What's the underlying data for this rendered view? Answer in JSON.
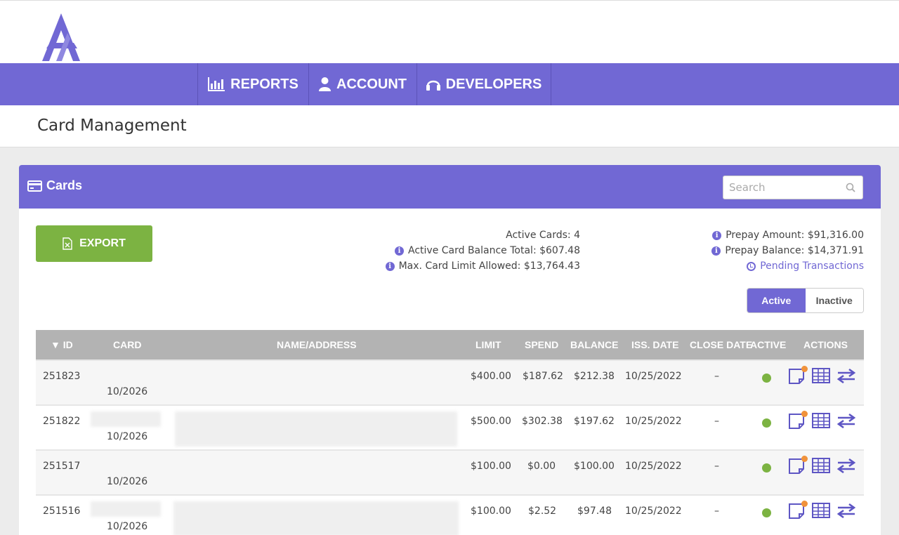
{
  "nav": {
    "items": [
      {
        "label": "REPORTS",
        "icon": "bar-chart-icon"
      },
      {
        "label": "ACCOUNT",
        "icon": "user-icon"
      },
      {
        "label": "DEVELOPERS",
        "icon": "headphones-icon"
      }
    ]
  },
  "page": {
    "title": "Card Management"
  },
  "panel": {
    "title": "Cards",
    "search_placeholder": "Search",
    "export_label": "EXPORT",
    "stats": {
      "active_cards": "Active Cards: 4",
      "active_balance_total": "Active Card Balance Total: $607.48",
      "max_card_limit": "Max. Card Limit Allowed: $13,764.43"
    },
    "prepay": {
      "amount": "Prepay Amount: $91,316.00",
      "balance": "Prepay Balance: $14,371.91",
      "pending": "Pending Transactions"
    },
    "toggle": {
      "active": "Active",
      "inactive": "Inactive"
    }
  },
  "table": {
    "columns": [
      "▼ ID",
      "CARD",
      "NAME/ADDRESS",
      "LIMIT",
      "SPEND",
      "BALANCE",
      "ISS. DATE",
      "CLOSE DATE",
      "ACTIVE",
      "ACTIONS"
    ],
    "rows": [
      {
        "id": "251823",
        "expiry": "10/2026",
        "limit": "$400.00",
        "spend": "$187.62",
        "balance": "$212.38",
        "iss_date": "10/25/2022",
        "close_date": "–",
        "active": true
      },
      {
        "id": "251822",
        "expiry": "10/2026",
        "limit": "$500.00",
        "spend": "$302.38",
        "balance": "$197.62",
        "iss_date": "10/25/2022",
        "close_date": "–",
        "active": true
      },
      {
        "id": "251517",
        "expiry": "10/2026",
        "limit": "$100.00",
        "spend": "$0.00",
        "balance": "$100.00",
        "iss_date": "10/25/2022",
        "close_date": "–",
        "active": true
      },
      {
        "id": "251516",
        "expiry": "10/2026",
        "limit": "$100.00",
        "spend": "$2.52",
        "balance": "$97.48",
        "iss_date": "10/25/2022",
        "close_date": "–",
        "active": true
      }
    ]
  },
  "colors": {
    "brand": "#7168d4",
    "export": "#7cb342",
    "active_dot": "#7cb342",
    "badge": "#f0923b"
  }
}
